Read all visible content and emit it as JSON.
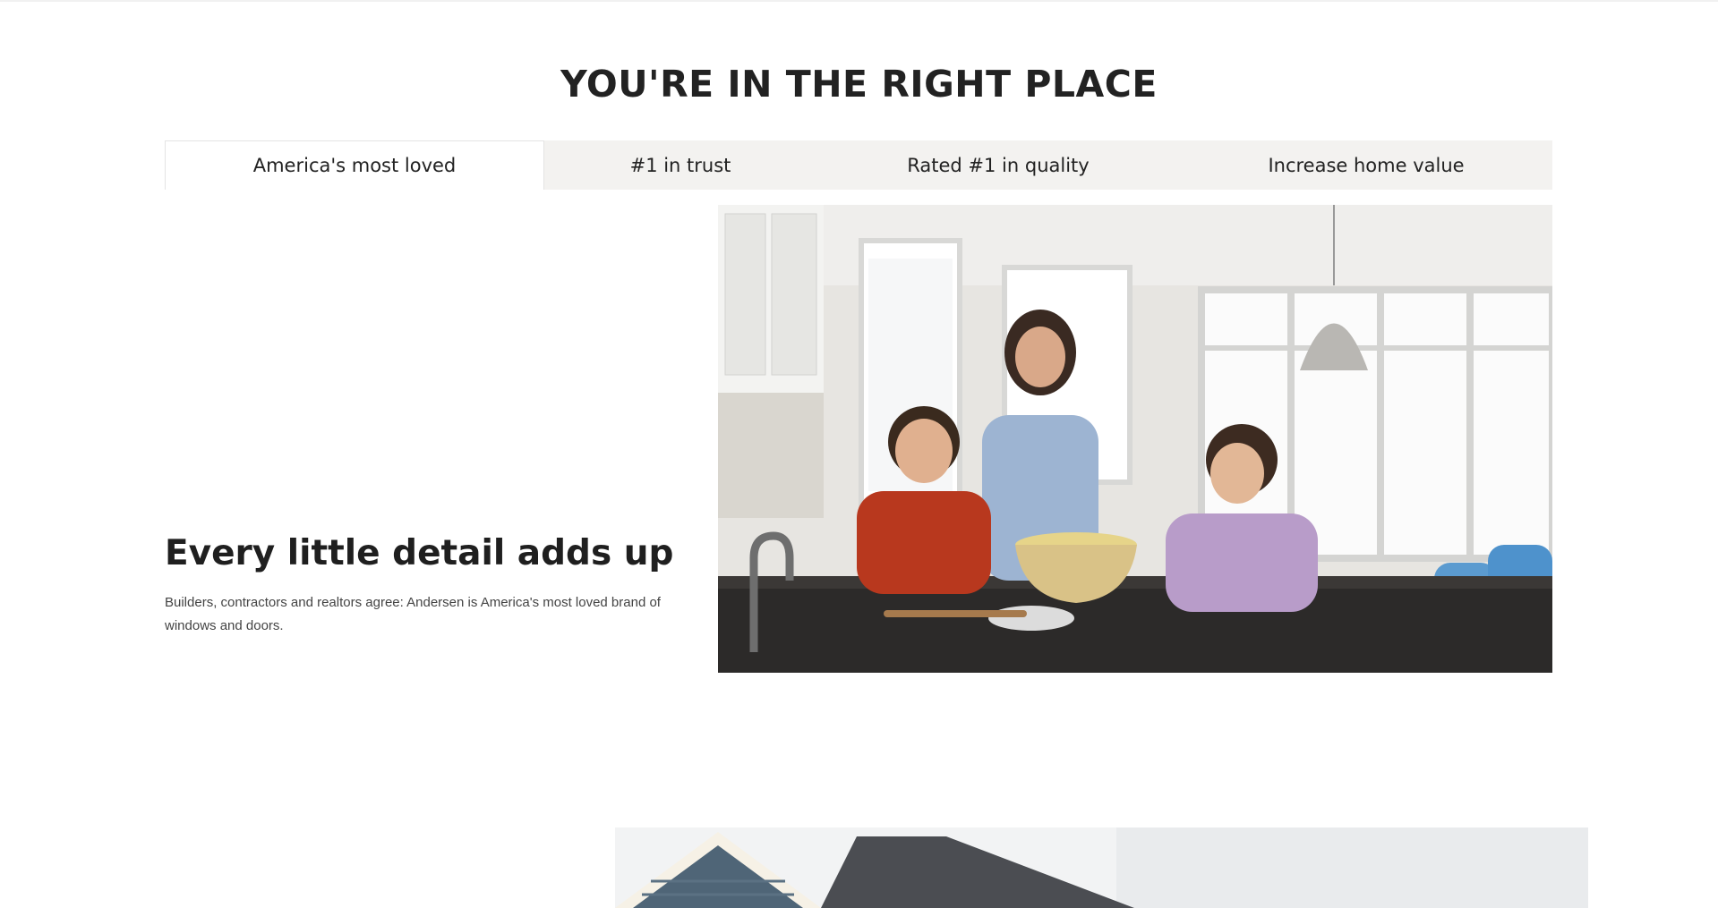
{
  "section": {
    "title": "YOU'RE IN THE RIGHT PLACE"
  },
  "tabs": [
    {
      "label": "America's most loved",
      "active": true
    },
    {
      "label": "#1 in trust",
      "active": false
    },
    {
      "label": "Rated #1 in quality",
      "active": false
    },
    {
      "label": "Increase home value",
      "active": false
    }
  ],
  "content": {
    "heading": "Every little detail adds up",
    "body": "Builders, contractors and realtors agree: Andersen is America's most loved brand of windows and doors."
  },
  "colors": {
    "tab_bar": "#f3f2f0",
    "active_tab": "#ffffff",
    "text": "#1f1f1f"
  }
}
